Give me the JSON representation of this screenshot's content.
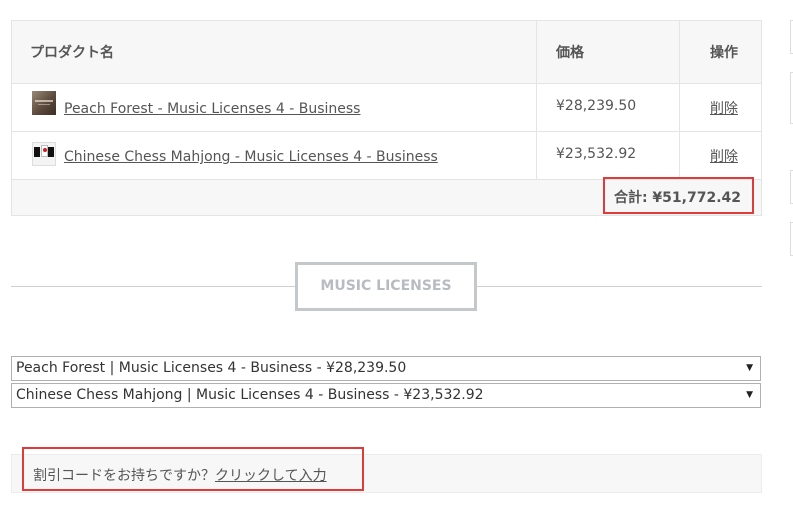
{
  "table": {
    "headers": {
      "product": "プロダクト名",
      "price": "価格",
      "action": "操作"
    },
    "rows": [
      {
        "name": "Peach Forest - Music Licenses 4 - Business",
        "price": "¥28,239.50",
        "remove": "削除",
        "thumb_icon": "peach-forest-thumbnail"
      },
      {
        "name": "Chinese Chess Mahjong - Music Licenses 4 - Business",
        "price": "¥23,532.92",
        "remove": "削除",
        "thumb_icon": "chinese-chess-mahjong-thumbnail"
      }
    ],
    "total": "合計: ¥51,772.42"
  },
  "section": {
    "title": "MUSIC LICENSES"
  },
  "selects": [
    {
      "value": "Peach Forest | Music Licenses 4 - Business - ¥28,239.50"
    },
    {
      "value": "Chinese Chess Mahjong | Music Licenses 4 - Business - ¥23,532.92"
    }
  ],
  "coupon": {
    "question": "割引コードをお持ちですか？",
    "link": "クリックして入力"
  },
  "colors": {
    "highlight": "#e03a3a",
    "border": "#e4e4e4",
    "header_bg": "#f7f7f7",
    "section_button_text": "#b7bcc0"
  }
}
